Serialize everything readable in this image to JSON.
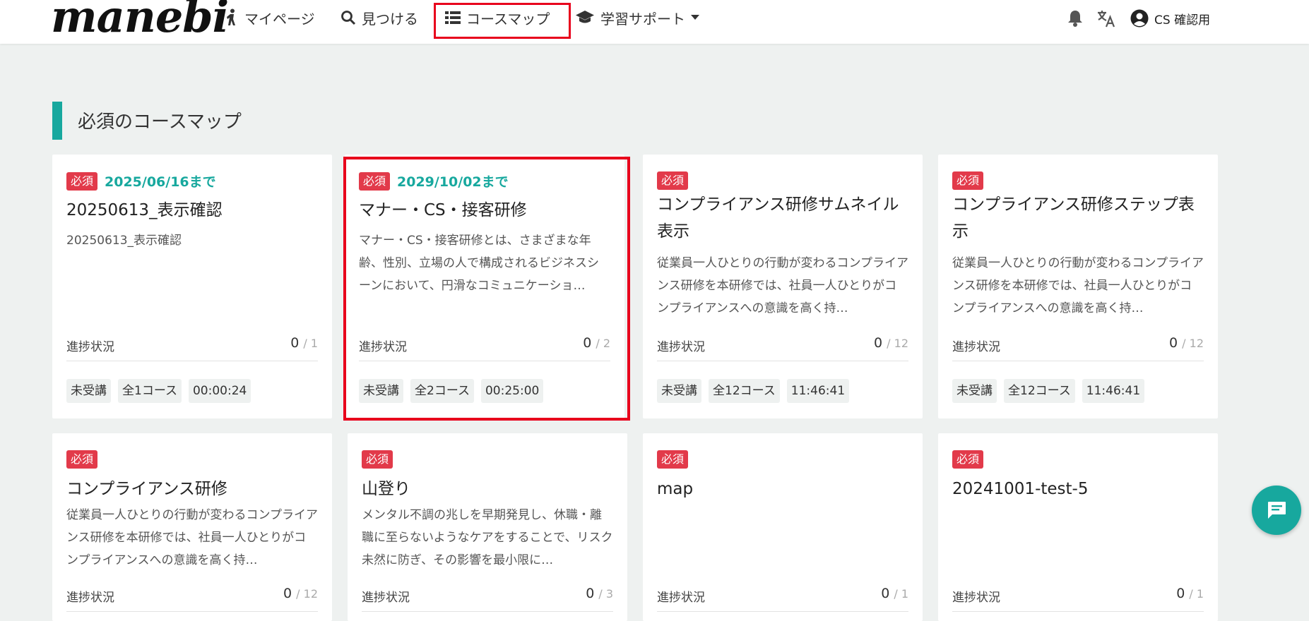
{
  "header": {
    "logo": "manebi",
    "nav": [
      {
        "label": "マイページ"
      },
      {
        "label": "見つける"
      },
      {
        "label": "コースマップ"
      },
      {
        "label": "学習サポート"
      }
    ],
    "user_name": "CS 確認用"
  },
  "section_title": "必須のコースマップ",
  "progress_label": "進捗状況",
  "required_badge": "必須",
  "cards": [
    {
      "deadline": "2025/06/16まで",
      "title": "20250613_表示確認",
      "desc": "20250613_表示確認",
      "progress": "0",
      "total": "/ 1",
      "status": "未受講",
      "courses": "全1コース",
      "duration": "00:00:24"
    },
    {
      "deadline": "2029/10/02まで",
      "title": "マナー・CS・接客研修",
      "desc": "マナー・CS・接客研修とは、さまざまな年齢、性別、立場の人で構成されるビジネスシーンにおいて、円滑なコミュニケーショ…",
      "progress": "0",
      "total": "/ 2",
      "status": "未受講",
      "courses": "全2コース",
      "duration": "00:25:00"
    },
    {
      "deadline": "",
      "title": "コンプライアンス研修サムネイル表示",
      "desc": "従業員一人ひとりの行動が変わるコンプライアンス研修を本研修では、社員一人ひとりがコンプライアンスへの意識を高く持…",
      "progress": "0",
      "total": "/ 12",
      "status": "未受講",
      "courses": "全12コース",
      "duration": "11:46:41"
    },
    {
      "deadline": "",
      "title": "コンプライアンス研修ステップ表示",
      "desc": "従業員一人ひとりの行動が変わるコンプライアンス研修を本研修では、社員一人ひとりがコンプライアンスへの意識を高く持…",
      "progress": "0",
      "total": "/ 12",
      "status": "未受講",
      "courses": "全12コース",
      "duration": "11:46:41"
    },
    {
      "deadline": "",
      "title": "コンプライアンス研修",
      "desc": "従業員一人ひとりの行動が変わるコンプライアンス研修を本研修では、社員一人ひとりがコンプライアンスへの意識を高く持…",
      "progress": "0",
      "total": "/ 12"
    },
    {
      "deadline": "",
      "title": "山登り",
      "desc": "メンタル不調の兆しを早期発見し、休職・離職に至らないようなケアをすることで、リスク未然に防ぎ、その影響を最小限に…",
      "progress": "0",
      "total": "/ 3"
    },
    {
      "deadline": "",
      "title": "map",
      "desc": "",
      "progress": "0",
      "total": "/ 1"
    },
    {
      "deadline": "",
      "title": "20241001-test-5",
      "desc": "",
      "progress": "0",
      "total": "/ 1"
    }
  ],
  "colors": {
    "accent": "#17a89e",
    "badge": "#e23a4a",
    "highlight": "#e8001c"
  }
}
